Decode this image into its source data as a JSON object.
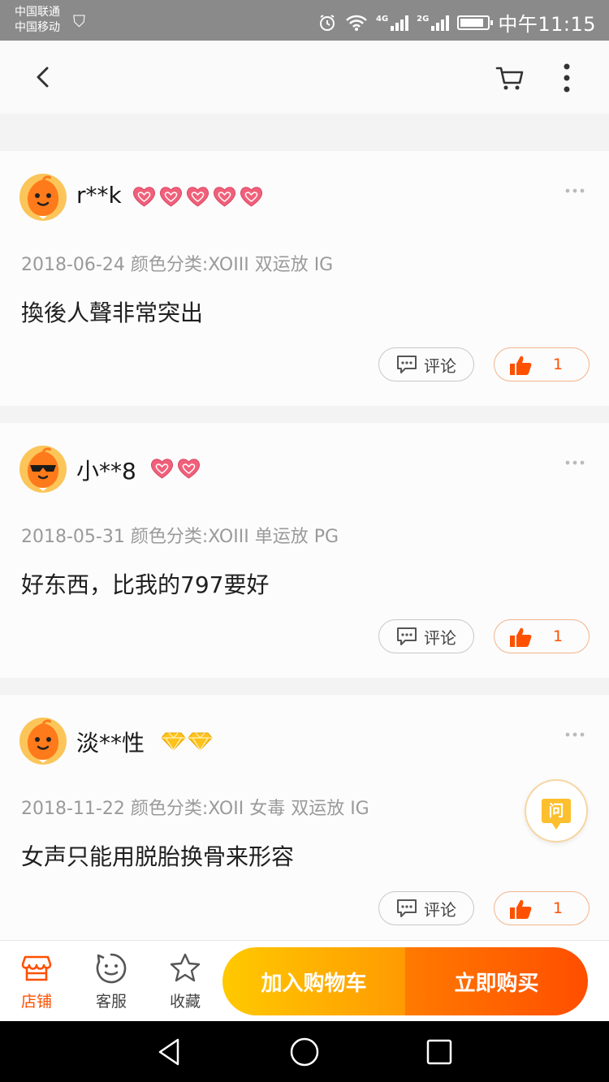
{
  "status_bar": {
    "carrier_1": "中国联通",
    "carrier_2": "中国移动",
    "network_1": "4G",
    "network_2": "2G",
    "time": "中午11:15"
  },
  "reviews": [
    {
      "username": "r**k",
      "badge_type": "heart",
      "badge_count": 5,
      "meta": "2018-06-24 颜色分类:XOIII 双运放 IG",
      "content": "換後人聲非常突出",
      "comment_label": "评论",
      "like_count": "1",
      "avatar_style": "plain"
    },
    {
      "username": "小**8",
      "badge_type": "heart",
      "badge_count": 2,
      "meta": "2018-05-31 颜色分类:XOIII 单运放 PG",
      "content": "好东西，比我的797要好",
      "comment_label": "评论",
      "like_count": "1",
      "avatar_style": "sunglasses"
    },
    {
      "username": "淡**性",
      "badge_type": "diamond",
      "badge_count": 2,
      "meta": "2018-11-22 颜色分类:XOII 女毒 双运放 IG",
      "content": "女声只能用脱胎换骨来形容",
      "comment_label": "评论",
      "like_count": "1",
      "avatar_style": "plain"
    }
  ],
  "ask_button": {
    "label": "问"
  },
  "action_bar": {
    "shop": "店铺",
    "service": "客服",
    "favorite": "收藏",
    "add_to_cart": "加入购物车",
    "buy_now": "立即购买"
  },
  "colors": {
    "accent": "#ff5000",
    "cart_gradient_start": "#ffc900",
    "buy_gradient_end": "#ff4e00",
    "heart_badge": "#f0607a",
    "diamond_badge": "#ffc21a"
  },
  "icons": [
    "back-icon",
    "cart-icon",
    "more-vertical-icon",
    "more-horizontal-icon",
    "comment-icon",
    "thumbs-up-icon",
    "store-icon",
    "service-smile-icon",
    "star-icon",
    "nav-back-icon",
    "nav-home-icon",
    "nav-recents-icon"
  ]
}
